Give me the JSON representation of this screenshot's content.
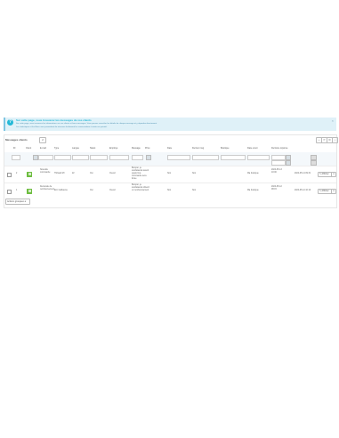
{
  "alert": {
    "title": "Sur cette page, vous trouverez les messages de vos clients",
    "lines": [
      "Sur cette page, vous trouverez les informations sur vos clients et leurs messages. Vous pouvez consulter les détails de chaque message et y répondre directement.",
      "Les statistiques et les filtres vous permettent de retrouver facilement les conversations à traiter en priorité."
    ]
  },
  "panel": {
    "title": "Messages clients",
    "count": "2",
    "tools": [
      "+",
      "⟳",
      "⚙",
      "⤓"
    ]
  },
  "columns": [
    "ID",
    "Client",
    "E-mail",
    "Type",
    "Langue",
    "Statut",
    "Employé",
    "Message",
    "Privé",
    "Date",
    "Dernier msg",
    "Boutique",
    "Date envoi",
    "Dernière réponse"
  ],
  "rows": [
    {
      "id": "2",
      "type": "Nouvelle commande",
      "name": "Thibault MI",
      "field": "22",
      "status": "Ouvert",
      "msg": "Bonjour, je souhaiterais savoir quand ma commande sera livrée",
      "c1": "Oui",
      "c2": "Non",
      "c3": "Non",
      "shop": "Ma boutique",
      "date": "2024-05-13 10:00",
      "last": "2024-05-14 09:31",
      "edit": "✎ Afficher"
    },
    {
      "id": "1",
      "type": "Demande de remboursement",
      "name": "Eric Guillaume",
      "field": "",
      "status": "Ouvert",
      "msg": "Bonjour, je souhaiterais obtenir un remboursement",
      "c1": "Oui",
      "c2": "Non",
      "c3": "Non",
      "shop": "Ma boutique",
      "date": "2024-05-12 08:15",
      "last": "2024-05-12 10:10",
      "edit": "✎ Afficher"
    }
  ],
  "bulk": "Actions groupées ▾",
  "filter_button": "Rechercher",
  "colors": {
    "accent": "#25b9d7",
    "thumb": "#6dbd3f"
  }
}
